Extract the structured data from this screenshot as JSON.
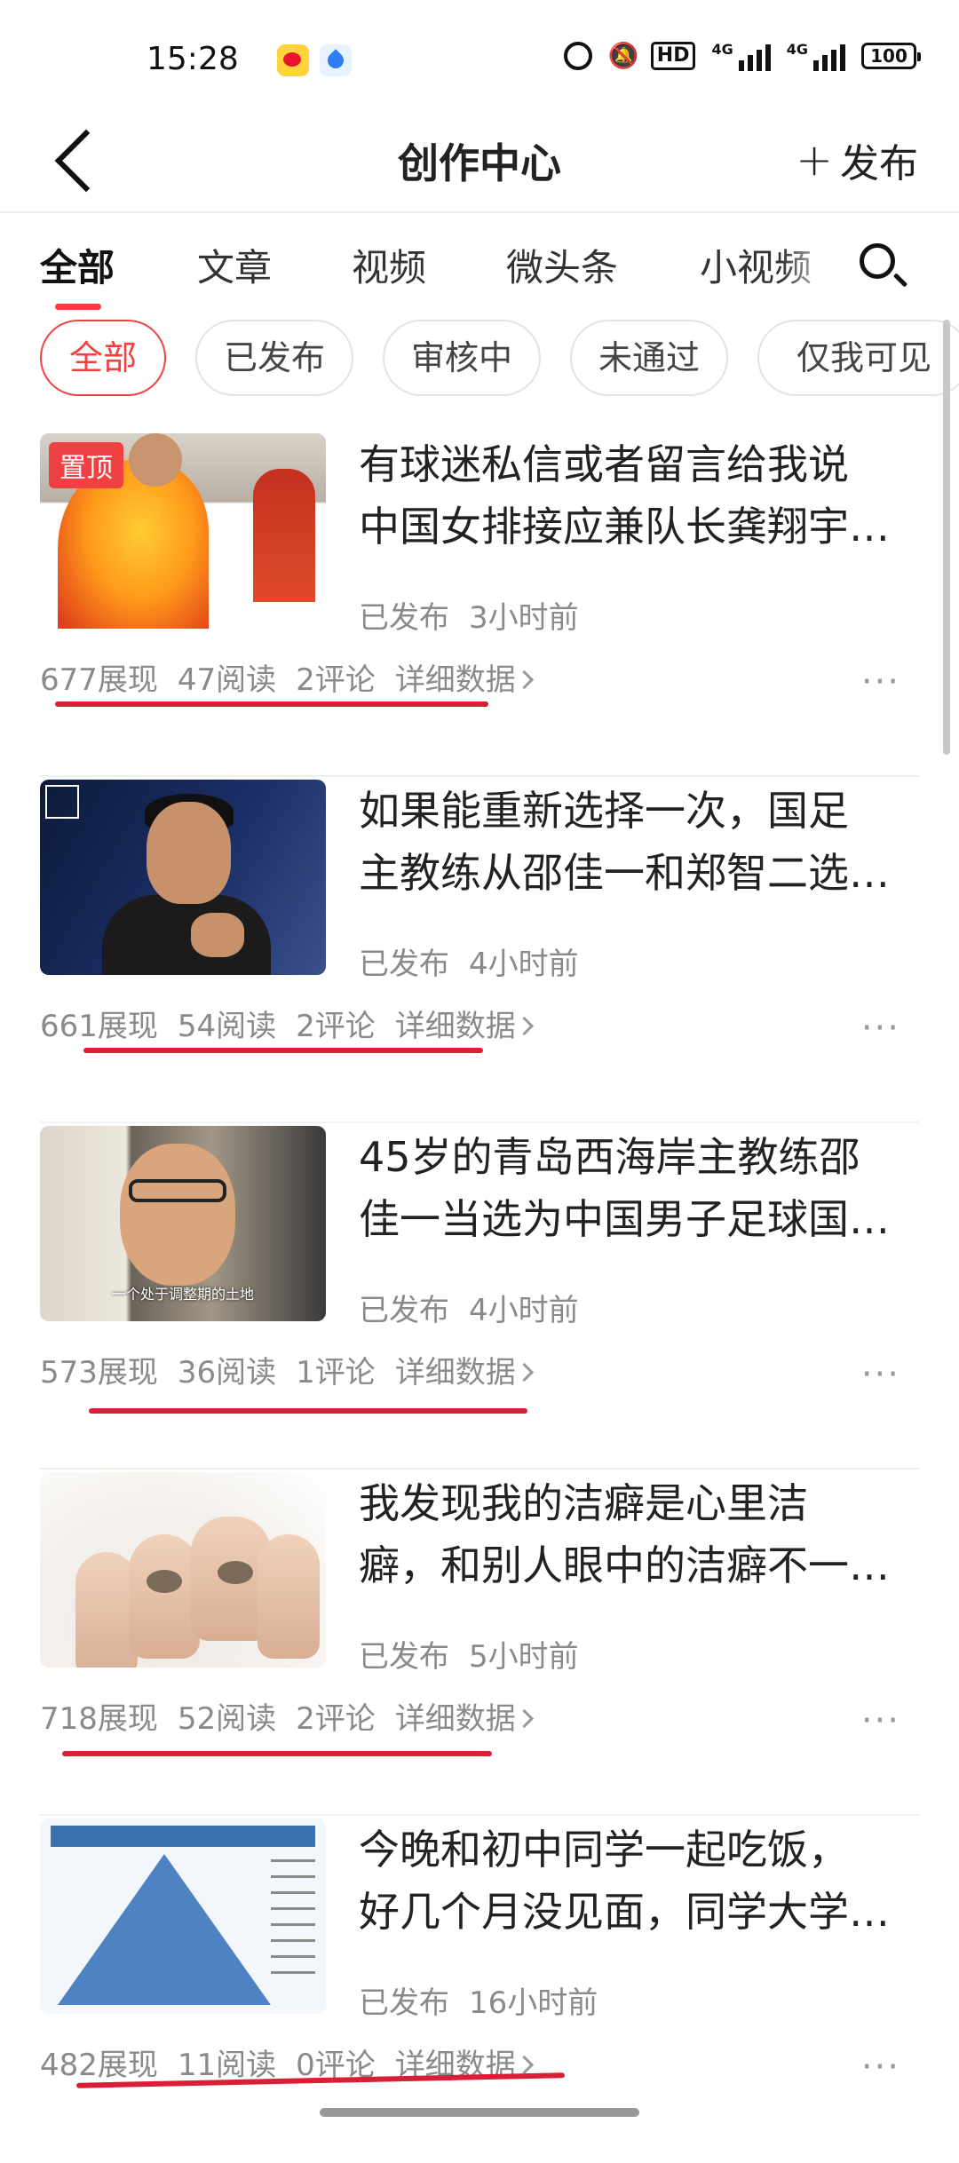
{
  "status_bar": {
    "time": "15:28",
    "battery": "100",
    "network": "4G"
  },
  "header": {
    "title": "创作中心",
    "publish_label": "发布"
  },
  "tabs": [
    "全部",
    "文章",
    "视频",
    "微头条",
    "小视频"
  ],
  "filters": [
    "全部",
    "已发布",
    "审核中",
    "未通过",
    "仅我可见"
  ],
  "posts": [
    {
      "pinned": "置顶",
      "title_line1": "有球迷私信或者留言给我说",
      "title_line2": "中国女排接应兼队长龚翔宇…",
      "status": "已发布",
      "time": "3小时前",
      "impressions": "677展现",
      "reads": "47阅读",
      "comments": "2评论",
      "details": "详细数据"
    },
    {
      "title_line1": "如果能重新选择一次，国足",
      "title_line2": "主教练从邵佳一和郑智二选…",
      "status": "已发布",
      "time": "4小时前",
      "impressions": "661展现",
      "reads": "54阅读",
      "comments": "2评论",
      "details": "详细数据"
    },
    {
      "title_line1": "45岁的青岛西海岸主教练邵",
      "title_line2": "佳一当选为中国男子足球国…",
      "thumb_caption": "一个处于调整期的土地",
      "status": "已发布",
      "time": "4小时前",
      "impressions": "573展现",
      "reads": "36阅读",
      "comments": "1评论",
      "details": "详细数据"
    },
    {
      "title_line1": "我发现我的洁癖是心里洁",
      "title_line2": "癖，和别人眼中的洁癖不一…",
      "status": "已发布",
      "time": "5小时前",
      "impressions": "718展现",
      "reads": "52阅读",
      "comments": "2评论",
      "details": "详细数据"
    },
    {
      "title_line1": "今晚和初中同学一起吃饭，",
      "title_line2": "好几个月没见面，同学大学…",
      "status": "已发布",
      "time": "16小时前",
      "impressions": "482展现",
      "reads": "11阅读",
      "comments": "0评论",
      "details": "详细数据"
    }
  ],
  "colors": {
    "accent": "#f04142",
    "annotation_underline": "#d91f35"
  }
}
